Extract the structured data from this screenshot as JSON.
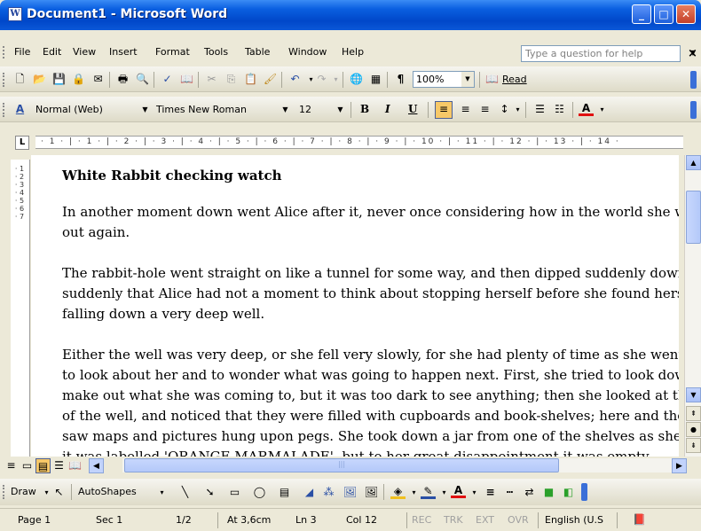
{
  "window": {
    "title": "Document1 - Microsoft Word",
    "minimize": "_",
    "maximize": "□",
    "close": "✕"
  },
  "menu": {
    "items": [
      "File",
      "Edit",
      "View",
      "Insert",
      "Format",
      "Tools",
      "Table",
      "Window",
      "Help"
    ],
    "help_placeholder": "Type a question for help"
  },
  "standard_toolbar": {
    "zoom": "100%",
    "read_label": "Read"
  },
  "format_toolbar": {
    "style": "Normal (Web)",
    "font": "Times New Roman",
    "size": "12",
    "bold": "B",
    "italic": "I",
    "underline": "U"
  },
  "ruler": {
    "text": "· 1 · | · 1 · | · 2 · | · 3 · | · 4 · | · 5 · | · 6 · | · 7 · | · 8 · | · 9 · | · 10 · | · 11 · | · 12 · | · 13 · | · 14 ·",
    "vertical": "· 1 · 2 · 3 · 4 · 5 · 6 · 7"
  },
  "document": {
    "heading": "White Rabbit checking watch",
    "paragraphs": [
      [
        "In another moment down went Alice after it, never once considering how in the world she was to get",
        "out again."
      ],
      [
        "The rabbit-hole went straight on like a tunnel for some way, and then dipped suddenly down, so",
        "suddenly that Alice had not a moment to think about stopping herself before she found herself",
        "falling down a very deep well."
      ],
      [
        "Either the well was very deep, or she fell very slowly, for she had plenty of time as she went down",
        "to look about her and to wonder what was going to happen next. First, she tried to look down and",
        "make out what she was coming to, but it was too dark to see anything; then she looked at the sides",
        "of the well, and noticed that they were filled with cupboards and book-shelves; here and there she",
        "saw maps and pictures hung upon pegs. She took down a jar from one of the shelves as she passed;",
        "it was labelled 'ORANGE MARMALADE', but to her great disappointment it was empty"
      ]
    ]
  },
  "drawing_toolbar": {
    "draw": "Draw",
    "autoshapes": "AutoShapes"
  },
  "status": {
    "page": "Page 1",
    "sec": "Sec 1",
    "pages": "1/2",
    "at": "At 3,6cm",
    "ln": "Ln 3",
    "col": "Col 12",
    "rec": "REC",
    "trk": "TRK",
    "ext": "EXT",
    "ovr": "OVR",
    "language": "English (U.S"
  }
}
